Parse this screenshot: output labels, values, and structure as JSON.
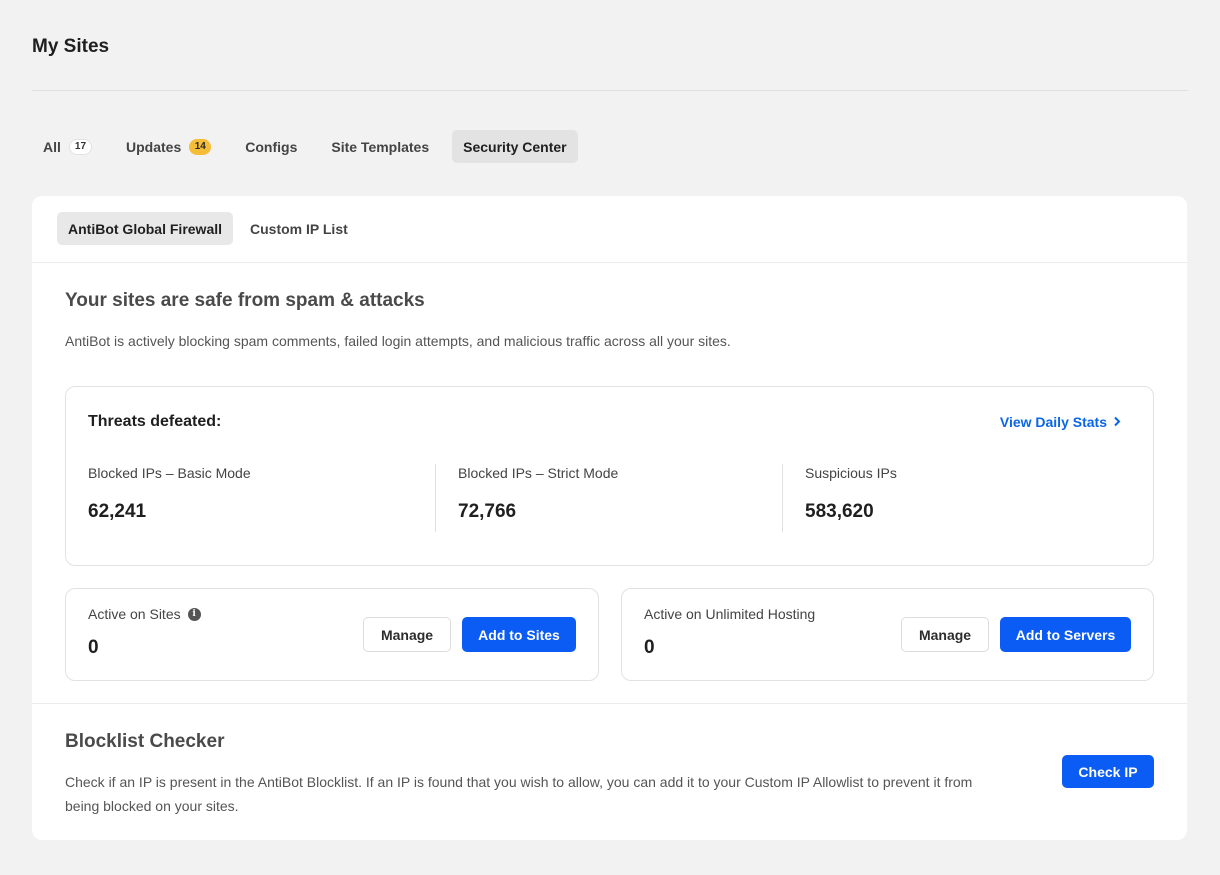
{
  "page": {
    "title": "My Sites"
  },
  "tabs": [
    {
      "label": "All",
      "badge": "17"
    },
    {
      "label": "Updates",
      "badge": "14"
    },
    {
      "label": "Configs"
    },
    {
      "label": "Site Templates"
    },
    {
      "label": "Security Center",
      "active": true
    }
  ],
  "subtabs": [
    {
      "label": "AntiBot Global Firewall",
      "active": true
    },
    {
      "label": "Custom IP List"
    }
  ],
  "firewall": {
    "title": "Your sites are safe from spam & attacks",
    "description": "AntiBot is actively blocking spam comments, failed login attempts, and malicious traffic across all your sites."
  },
  "threats": {
    "title": "Threats defeated:",
    "view_stats_label": "View Daily Stats",
    "stats": [
      {
        "label": "Blocked IPs – Basic Mode",
        "value": "62,241"
      },
      {
        "label": "Blocked IPs – Strict Mode",
        "value": "72,766"
      },
      {
        "label": "Suspicious IPs",
        "value": "583,620"
      }
    ]
  },
  "active_sites": {
    "label": "Active on Sites",
    "value": "0",
    "manage_label": "Manage",
    "add_label": "Add to Sites"
  },
  "active_hosting": {
    "label": "Active on Unlimited Hosting",
    "value": "0",
    "manage_label": "Manage",
    "add_label": "Add to Servers"
  },
  "blocklist": {
    "title": "Blocklist Checker",
    "description_line1": "Check if an IP is present in the AntiBot Blocklist. If an IP is found that you wish to allow, you can add it to your Custom IP Allowlist to prevent it from",
    "description_line2": "being blocked on your sites.",
    "button_label": "Check IP"
  },
  "colors": {
    "primary": "#0a5cf5",
    "link": "#0a66e8",
    "badge_yellow": "#f6bd38"
  }
}
